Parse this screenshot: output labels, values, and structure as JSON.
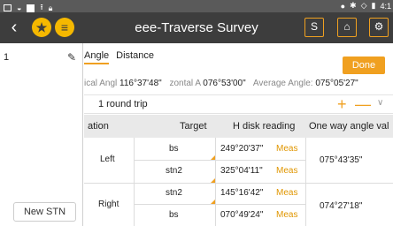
{
  "status_bar": {
    "clock": "4:1"
  },
  "title_bar": {
    "title": "eee-Traverse Survey",
    "btn_s": "S"
  },
  "sidebar": {
    "station_number": "1",
    "new_station_label": "New STN"
  },
  "tabs": [
    {
      "label": "Angle",
      "active": true
    },
    {
      "label": "Distance",
      "active": false
    }
  ],
  "done_label": "Done",
  "angles": {
    "h_label": "ical Angl",
    "h_value": "116°37'48\"",
    "z_label": "zontal A",
    "z_value": "076°53'00\"",
    "avg_label": "Average Angle:",
    "avg_value": "075°05'27\""
  },
  "round_trip": "1 round trip",
  "table": {
    "headers": [
      "ation",
      "Target",
      "H disk reading",
      "One way angle val"
    ],
    "groups": [
      {
        "position": "Left",
        "one_way": "075°43'35\"",
        "rows": [
          {
            "target": "bs",
            "reading": "249°20'37\"",
            "meas": "Meas"
          },
          {
            "target": "stn2",
            "reading": "325°04'11\"",
            "meas": "Meas"
          }
        ]
      },
      {
        "position": "Right",
        "one_way": "074°27'18\"",
        "rows": [
          {
            "target": "stn2",
            "reading": "145°16'42\"",
            "meas": "Meas"
          },
          {
            "target": "bs",
            "reading": "070°49'24\"",
            "meas": "Meas"
          }
        ]
      }
    ]
  },
  "colors": {
    "accent": "#f0a020",
    "titlebar": "#3d3d3d",
    "statusbar": "#5a5a5a"
  }
}
